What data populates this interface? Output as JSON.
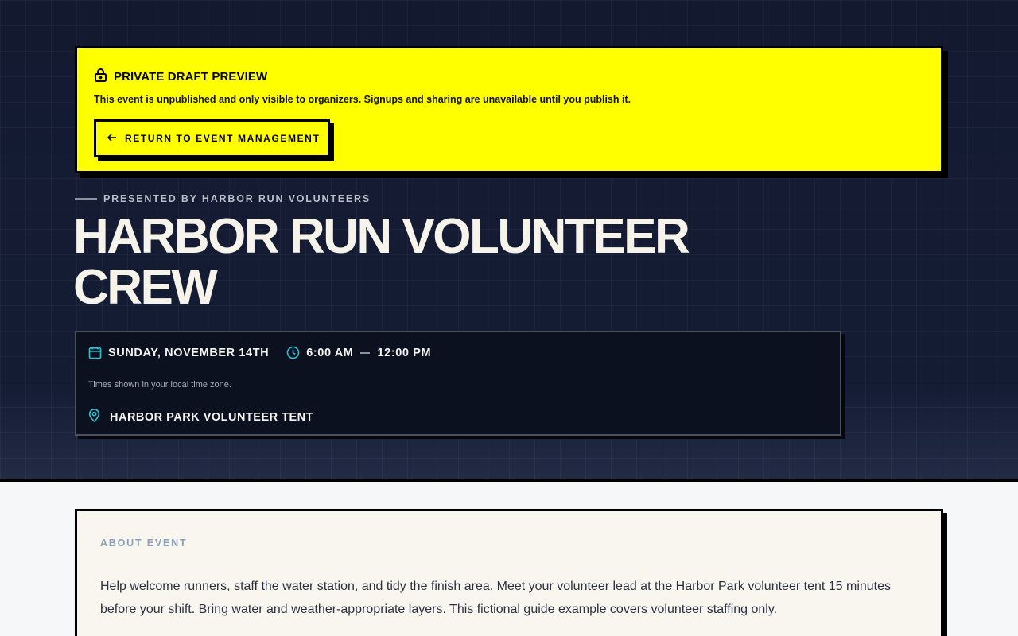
{
  "draft_banner": {
    "title": "PRIVATE DRAFT PREVIEW",
    "message": "This event is unpublished and only visible to organizers. Signups and sharing are unavailable until you publish it.",
    "return_button": "RETURN TO EVENT MANAGEMENT",
    "background_color": "#ffff00"
  },
  "event": {
    "presented_by": "PRESENTED BY HARBOR RUN VOLUNTEERS",
    "title": "HARBOR RUN VOLUNTEER CREW",
    "date": "SUNDAY, NOVEMBER 14TH",
    "start_time": "6:00 AM",
    "end_time": "12:00 PM",
    "timezone_note": "Times shown in your local time zone.",
    "location": "HARBOR PARK VOLUNTEER TENT",
    "accent_color": "#2ec5d3"
  },
  "about": {
    "label": "ABOUT EVENT",
    "description": "Help welcome runners, staff the water station, and tidy the finish area. Meet your volunteer lead at the Harbor Park volunteer tent 15 minutes before your shift. Bring water and weather-appropriate layers. This fictional guide example covers volunteer staffing only."
  },
  "icons": {
    "lock": "lock-icon",
    "back": "arrow-left-icon",
    "calendar": "calendar-icon",
    "clock": "clock-icon",
    "location": "map-pin-icon"
  }
}
